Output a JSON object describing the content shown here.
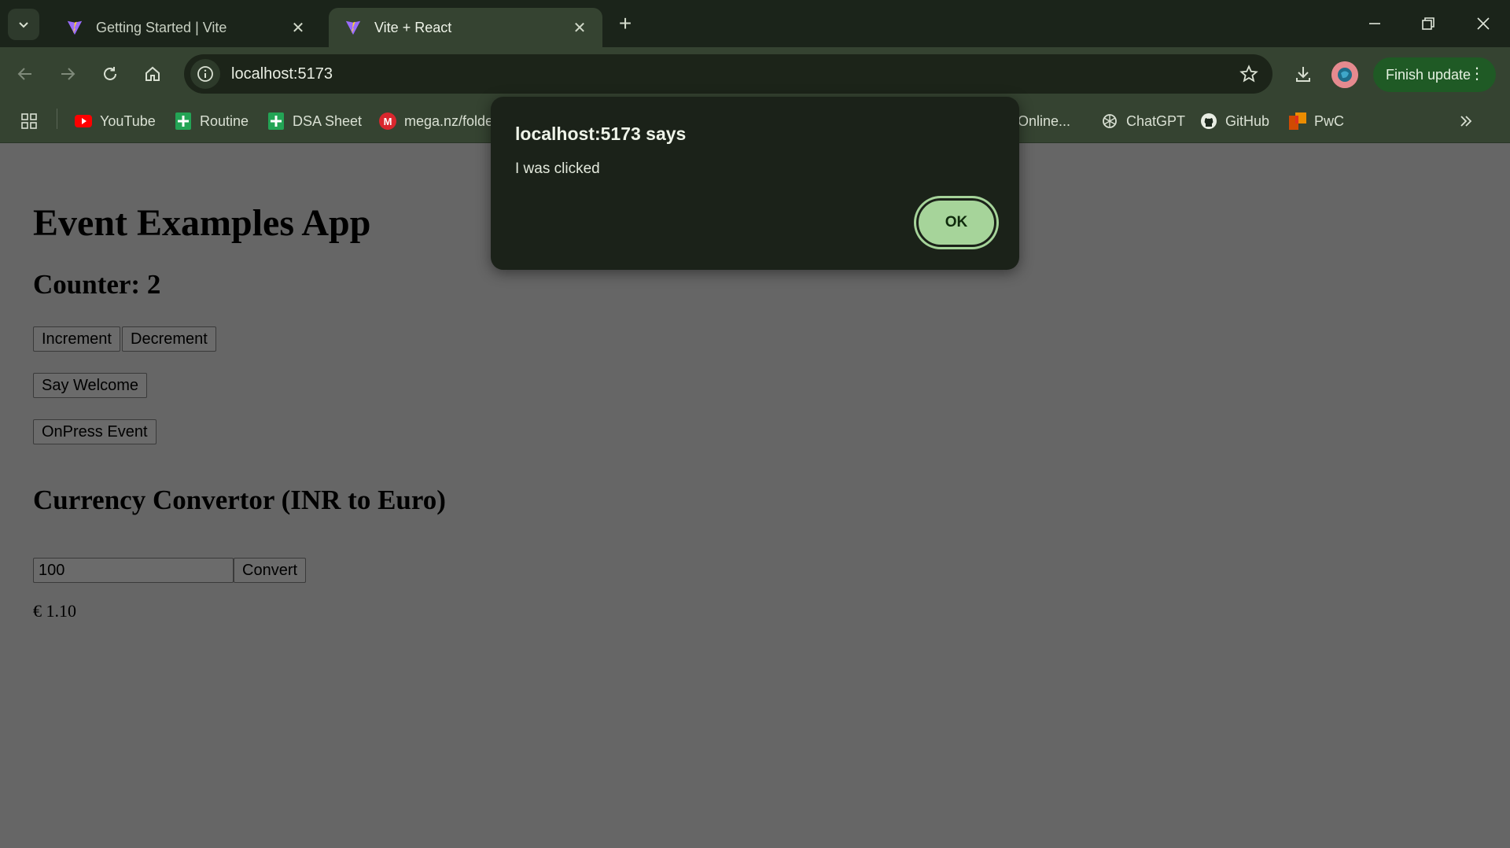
{
  "browser": {
    "tabs": [
      {
        "title": "Getting Started | Vite",
        "favicon": "vite-logo"
      },
      {
        "title": "Vite + React",
        "favicon": "vite-logo"
      }
    ],
    "url": "localhost:5173",
    "finish_update_label": "Finish update",
    "bookmarks": [
      {
        "label": "YouTube",
        "icon": "youtube-icon"
      },
      {
        "label": "Routine",
        "icon": "sheets-icon"
      },
      {
        "label": "DSA Sheet",
        "icon": "sheets-icon"
      },
      {
        "label": "mega.nz/folde",
        "icon": "mega-icon"
      },
      {
        "label": "Online...",
        "icon": "bookmark-icon"
      },
      {
        "label": "ChatGPT",
        "icon": "chatgpt-icon"
      },
      {
        "label": "GitHub",
        "icon": "github-icon"
      },
      {
        "label": "PwC",
        "icon": "pwc-icon"
      }
    ]
  },
  "app": {
    "title": "Event Examples App",
    "counter_heading": "Counter: 2",
    "increment_label": "Increment",
    "decrement_label": "Decrement",
    "say_welcome_label": "Say Welcome",
    "onpress_label": "OnPress Event",
    "converter_heading": "Currency Convertor (INR to Euro)",
    "amount_value": "100",
    "convert_label": "Convert",
    "result": "€ 1.10"
  },
  "alert": {
    "title": "localhost:5173 says",
    "message": "I was clicked",
    "ok_label": "OK"
  },
  "colors": {
    "chrome_bg": "#1b241a",
    "toolbar_bg": "#354331",
    "page_dim_bg": "#666666",
    "dialog_bg": "#1b2219",
    "ok_button": "#a6d49a",
    "finish_update_bg": "#1f5a25"
  }
}
